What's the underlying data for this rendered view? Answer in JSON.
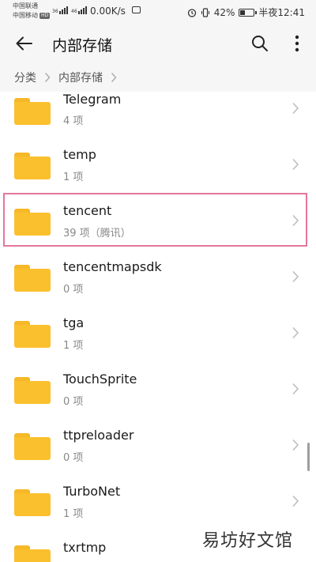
{
  "status_bar": {
    "carrier1": "中国联通",
    "carrier2": "中国移动",
    "hd_badge": "HD",
    "signal1_label": "36",
    "signal2_label": "46",
    "net_speed": "0.00K/s",
    "battery_percent": "42%",
    "time": "半夜12:41"
  },
  "toolbar": {
    "title": "内部存储",
    "back_icon": "back-arrow-icon",
    "search_icon": "search-icon",
    "more_icon": "more-vert-icon"
  },
  "breadcrumb": {
    "items": [
      "分类",
      "内部存储"
    ]
  },
  "files": [
    {
      "name": "Telegram",
      "meta": "4 项"
    },
    {
      "name": "temp",
      "meta": "1 项"
    },
    {
      "name": "tencent",
      "meta": "39 项（腾讯）"
    },
    {
      "name": "tencentmapsdk",
      "meta": "0 项"
    },
    {
      "name": "tga",
      "meta": "1 项"
    },
    {
      "name": "TouchSprite",
      "meta": "0 项"
    },
    {
      "name": "ttpreloader",
      "meta": "0 项"
    },
    {
      "name": "TurboNet",
      "meta": "1 项"
    },
    {
      "name": "txrtmp",
      "meta": ""
    }
  ],
  "colors": {
    "folder": "#fbc02d",
    "highlight": "#e4769d",
    "bar_bg": "#f6f6f6"
  },
  "watermark": "易坊好文馆"
}
